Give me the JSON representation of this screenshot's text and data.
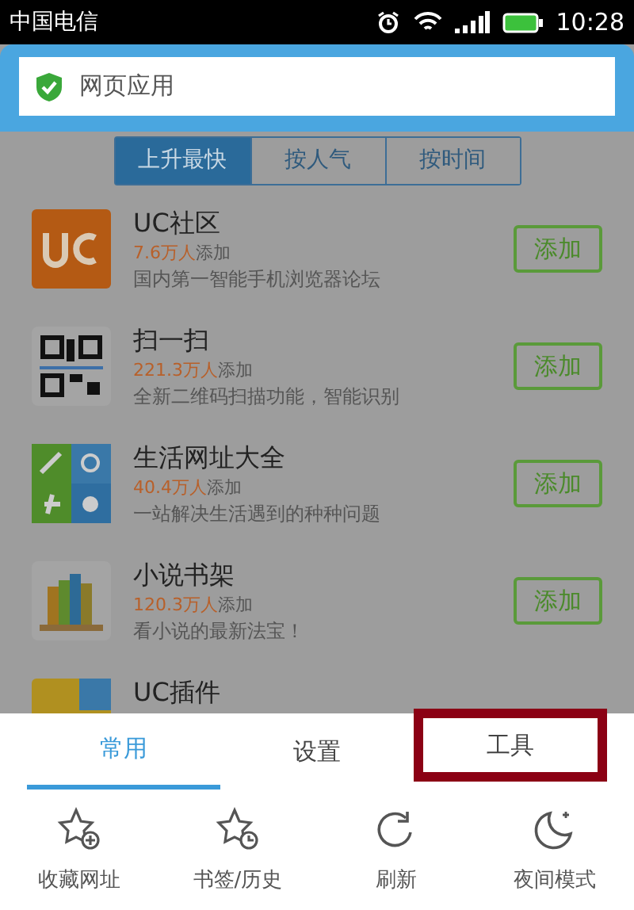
{
  "status_bar": {
    "carrier": "中国电信",
    "time": "10:28"
  },
  "address_bar": {
    "value": "网页应用"
  },
  "sort_tabs": [
    {
      "label": "上升最快",
      "selected": true
    },
    {
      "label": "按人气",
      "selected": false
    },
    {
      "label": "按时间",
      "selected": false
    }
  ],
  "apps": [
    {
      "kind": "uc",
      "name": "UC社区",
      "count": "7.6万人",
      "count_suffix": "添加",
      "description": "国内第一智能手机浏览器论坛",
      "button": "添加"
    },
    {
      "kind": "qr",
      "name": "扫一扫",
      "count": "221.3万人",
      "count_suffix": "添加",
      "description": "全新二维码扫描功能，智能识别",
      "button": "添加"
    },
    {
      "kind": "tiles",
      "name": "生活网址大全",
      "count": "40.4万人",
      "count_suffix": "添加",
      "description": "一站解决生活遇到的种种问题",
      "button": "添加"
    },
    {
      "kind": "books",
      "name": "小说书架",
      "count": "120.3万人",
      "count_suffix": "添加",
      "description": "看小说的最新法宝！",
      "button": "添加"
    },
    {
      "kind": "plugin",
      "name": "UC插件"
    }
  ],
  "menu_tabs": [
    {
      "label": "常用",
      "selected": true,
      "highlighted": false
    },
    {
      "label": "设置",
      "selected": false,
      "highlighted": false
    },
    {
      "label": "工具",
      "selected": false,
      "highlighted": true
    }
  ],
  "menu_items": [
    {
      "kind": "star-plus",
      "label": "收藏网址"
    },
    {
      "kind": "star-clock",
      "label": "书签/历史"
    },
    {
      "kind": "refresh",
      "label": "刷新"
    },
    {
      "kind": "moon",
      "label": "夜间模式"
    }
  ]
}
